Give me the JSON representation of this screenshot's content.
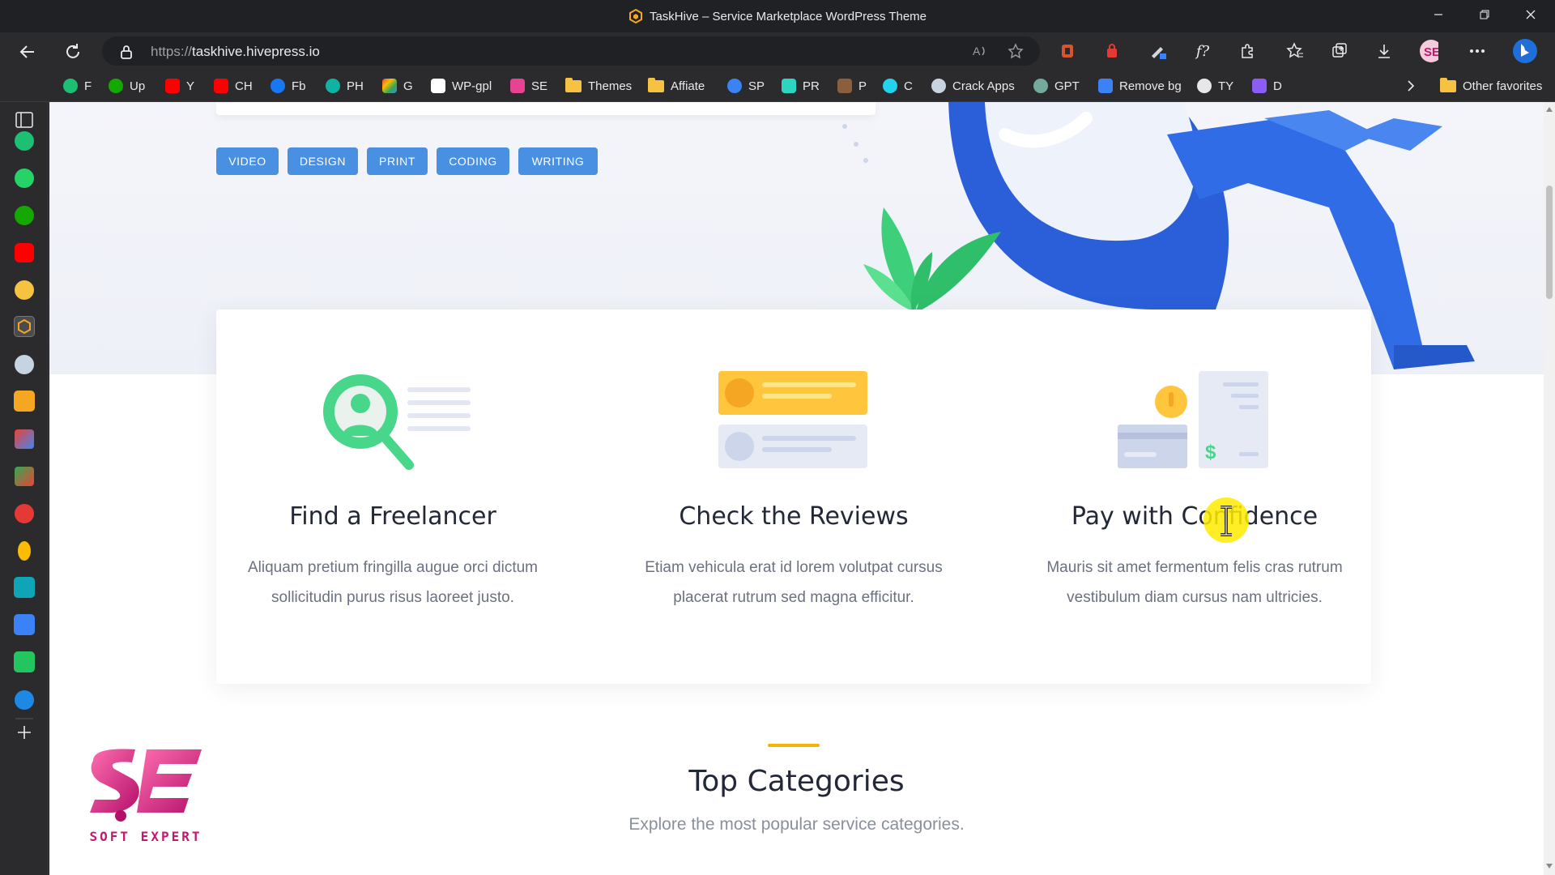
{
  "window": {
    "title": "TaskHive – Service Marketplace WordPress Theme",
    "controls": [
      "minimize",
      "restore",
      "close"
    ]
  },
  "address_bar": {
    "protocol": "https://",
    "host": "taskhive.hivepress.io"
  },
  "bookmarks": [
    {
      "label": "F",
      "icon": "green-circle",
      "color": "#1dbf73"
    },
    {
      "label": "Up",
      "icon": "upwork-icon",
      "color": "#14a800"
    },
    {
      "label": "Y",
      "icon": "youtube-icon",
      "color": "#ff0000"
    },
    {
      "label": "CH",
      "icon": "youtube-icon",
      "color": "#ff0000"
    },
    {
      "label": "Fb",
      "icon": "facebook-icon",
      "color": "#1877f2"
    },
    {
      "label": "PH",
      "icon": "ph-icon",
      "color": "#10b3a3"
    },
    {
      "label": "G",
      "icon": "gmail-icon",
      "color": "#ea4335"
    },
    {
      "label": "WP-gpl",
      "icon": "wm-icon",
      "color": "#ffffff"
    },
    {
      "label": "SE",
      "icon": "se-icon",
      "color": "#e84393"
    },
    {
      "label": "Themes",
      "icon": "folder-icon",
      "color": "#f5c242"
    },
    {
      "label": "Affiate",
      "icon": "folder-icon",
      "color": "#f5c242"
    },
    {
      "label": "SP",
      "icon": "sp-icon",
      "color": "#3b82f6"
    },
    {
      "label": "PR",
      "icon": "pr-icon",
      "color": "#2dd4bf"
    },
    {
      "label": "P",
      "icon": "p-icon",
      "color": "#8b5e3c"
    },
    {
      "label": "C",
      "icon": "c-icon",
      "color": "#22d3ee"
    },
    {
      "label": "Crack Apps",
      "icon": "wordpress-icon",
      "color": "#c6d4e1"
    },
    {
      "label": "GPT",
      "icon": "gpt-icon",
      "color": "#74aa9c"
    },
    {
      "label": "Remove bg",
      "icon": "removebg-icon",
      "color": "#3b82f6"
    },
    {
      "label": "TY",
      "icon": "ty-icon",
      "color": "#e5e7eb"
    },
    {
      "label": "D",
      "icon": "d-icon",
      "color": "#8b5cf6"
    }
  ],
  "other_favorites": "Other favorites",
  "tags": [
    "VIDEO",
    "DESIGN",
    "PRINT",
    "CODING",
    "WRITING"
  ],
  "features": [
    {
      "title": "Find a Freelancer",
      "line1": "Aliquam pretium fringilla augue orci dictum",
      "line2": "sollicitudin purus risus laoreet justo."
    },
    {
      "title": "Check the Reviews",
      "line1": "Etiam vehicula erat id lorem volutpat cursus",
      "line2": "placerat rutrum sed magna efficitur."
    },
    {
      "title": "Pay with Confidence",
      "line1": "Mauris sit amet fermentum felis cras rutrum",
      "line2": "vestibulum diam cursus nam ultricies."
    }
  ],
  "categories": {
    "title": "Top Categories",
    "subtitle": "Explore the most popular service categories."
  },
  "watermark": {
    "text": "SOFT EXPERT"
  },
  "colors": {
    "tag_blue": "#4a90e2",
    "accent_yellow": "#f5b400",
    "hero_blue": "#2b5fd9",
    "leaf_green": "#3ecf7a"
  }
}
